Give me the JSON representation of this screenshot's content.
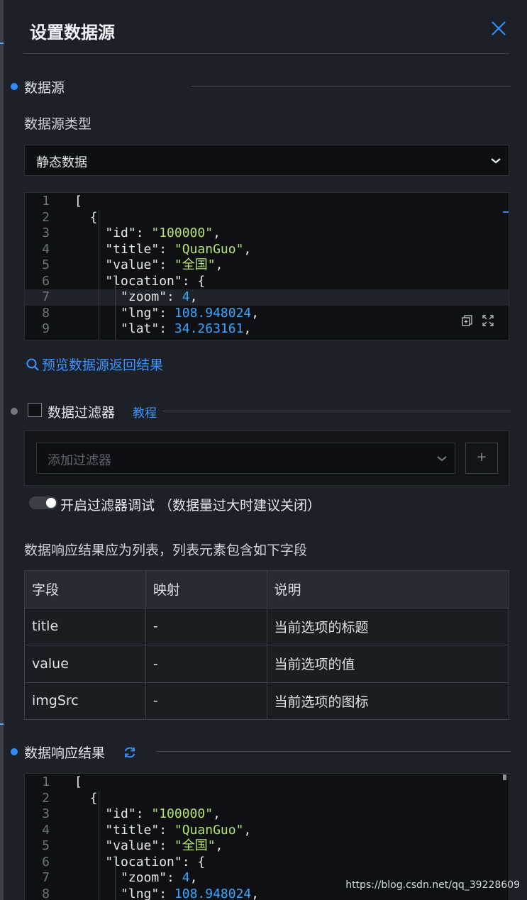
{
  "panel": {
    "title": "设置数据源"
  },
  "datasource_section": {
    "label": "数据源",
    "type_label": "数据源类型",
    "type_value": "静态数据",
    "preview_link": "预览数据源返回结果"
  },
  "code_lines": [
    {
      "n": "1",
      "parts": [
        {
          "t": "["
        }
      ]
    },
    {
      "n": "2",
      "parts": [
        {
          "t": "  {"
        }
      ]
    },
    {
      "n": "3",
      "parts": [
        {
          "t": "    \"id\": "
        },
        {
          "t": "\"100000\"",
          "c": "str"
        },
        {
          "t": ","
        }
      ]
    },
    {
      "n": "4",
      "parts": [
        {
          "t": "    \"title\": "
        },
        {
          "t": "\"QuanGuo\"",
          "c": "str"
        },
        {
          "t": ","
        }
      ]
    },
    {
      "n": "5",
      "parts": [
        {
          "t": "    \"value\": "
        },
        {
          "t": "\"全国\"",
          "c": "str"
        },
        {
          "t": ","
        }
      ]
    },
    {
      "n": "6",
      "parts": [
        {
          "t": "    \"location\": {"
        }
      ]
    },
    {
      "n": "7",
      "parts": [
        {
          "t": "      \"zoom\": "
        },
        {
          "t": "4",
          "c": "num"
        },
        {
          "t": ","
        }
      ]
    },
    {
      "n": "8",
      "parts": [
        {
          "t": "      \"lng\": "
        },
        {
          "t": "108.948024",
          "c": "num"
        },
        {
          "t": ","
        }
      ]
    },
    {
      "n": "9",
      "parts": [
        {
          "t": "      \"lat\": "
        },
        {
          "t": "34.263161",
          "c": "num"
        },
        {
          "t": ","
        }
      ]
    }
  ],
  "filter_section": {
    "label": "数据过滤器",
    "tutorial_link": "教程",
    "placeholder": "添加过滤器",
    "add_button": "+",
    "debug_toggle_label": "开启过滤器调试 （数据量过大时建议关闭）",
    "debug_toggle_on": true
  },
  "mapping": {
    "info": "数据响应结果应为列表，列表元素包含如下字段",
    "headers": [
      "字段",
      "映射",
      "说明"
    ],
    "rows": [
      [
        "title",
        "-",
        "当前选项的标题"
      ],
      [
        "value",
        "-",
        "当前选项的值"
      ],
      [
        "imgSrc",
        "-",
        "当前选项的图标"
      ]
    ]
  },
  "result_section": {
    "label": "数据响应结果"
  },
  "result_lines": [
    {
      "n": "1",
      "parts": [
        {
          "t": "["
        }
      ]
    },
    {
      "n": "2",
      "parts": [
        {
          "t": "  {"
        }
      ]
    },
    {
      "n": "3",
      "parts": [
        {
          "t": "    \"id\": "
        },
        {
          "t": "\"100000\"",
          "c": "str"
        },
        {
          "t": ","
        }
      ]
    },
    {
      "n": "4",
      "parts": [
        {
          "t": "    \"title\": "
        },
        {
          "t": "\"QuanGuo\"",
          "c": "str"
        },
        {
          "t": ","
        }
      ]
    },
    {
      "n": "5",
      "parts": [
        {
          "t": "    \"value\": "
        },
        {
          "t": "\"全国\"",
          "c": "str"
        },
        {
          "t": ","
        }
      ]
    },
    {
      "n": "6",
      "parts": [
        {
          "t": "    \"location\": {"
        }
      ]
    },
    {
      "n": "7",
      "parts": [
        {
          "t": "      \"zoom\": "
        },
        {
          "t": "4",
          "c": "num"
        },
        {
          "t": ","
        }
      ]
    },
    {
      "n": "8",
      "parts": [
        {
          "t": "      \"lng\": "
        },
        {
          "t": "108.948024",
          "c": "num"
        },
        {
          "t": ","
        }
      ]
    }
  ],
  "watermark": "https://blog.csdn.net/qq_39228609",
  "icons": {
    "close": "close-icon",
    "caret": "chevron-down-icon",
    "search": "search-icon",
    "copy": "copy-icon",
    "fullscreen": "fullscreen-icon",
    "refresh": "refresh-icon"
  },
  "colors": {
    "accent": "#2f8cff",
    "string": "#b6e36e",
    "number": "#3aa6ff"
  }
}
